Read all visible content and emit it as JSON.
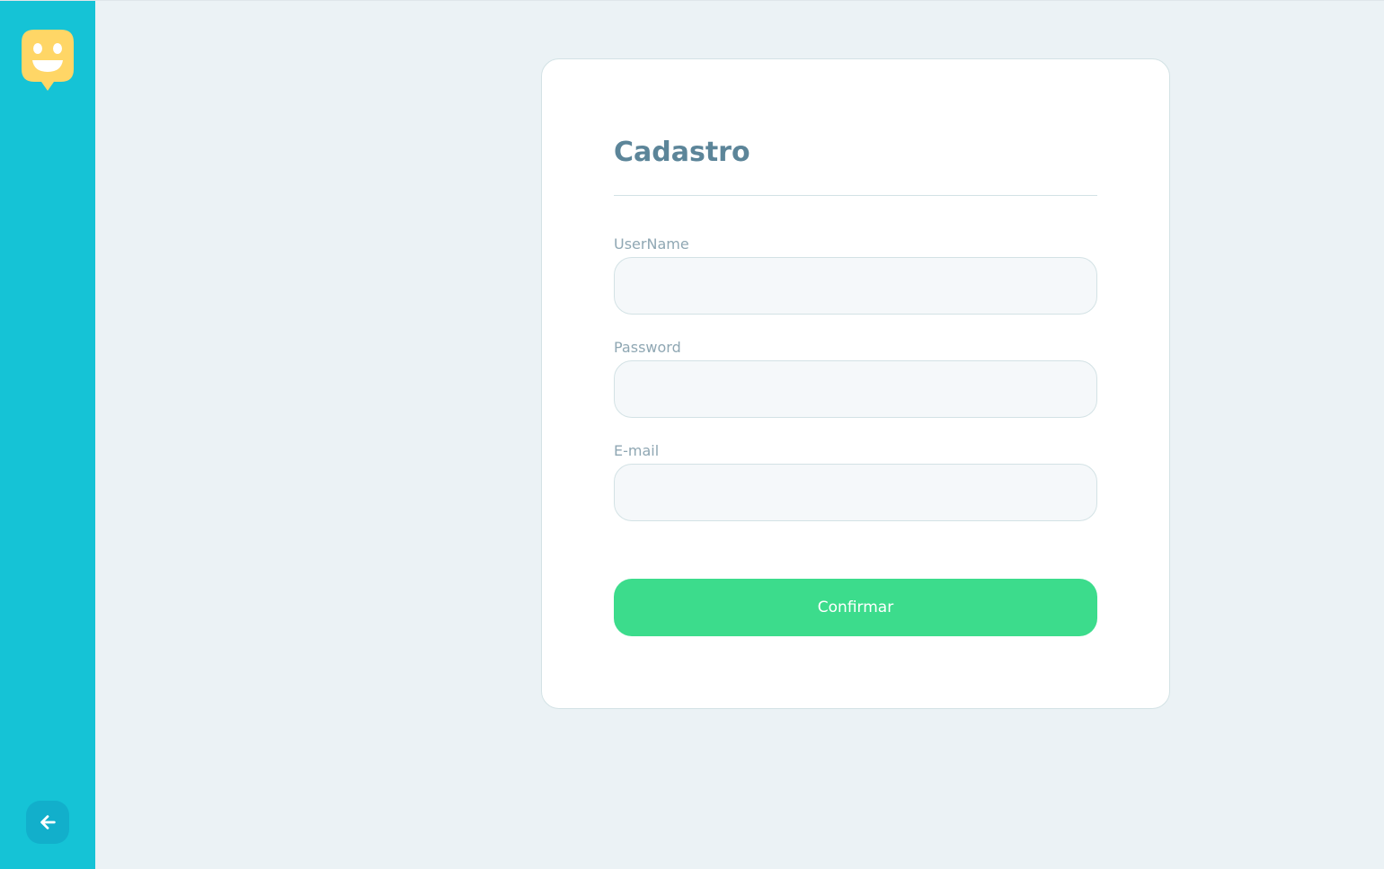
{
  "sidebar": {
    "logo_icon": "smiley-speech-bubble-icon",
    "back_icon": "arrow-left-icon",
    "colors": {
      "background": "#15c3d6",
      "back_button": "#12afcb",
      "logo": "#ffd666"
    }
  },
  "form": {
    "title": "Cadastro",
    "fields": [
      {
        "label": "UserName",
        "value": "",
        "placeholder": ""
      },
      {
        "label": "Password",
        "value": "",
        "placeholder": ""
      },
      {
        "label": "E-mail",
        "value": "",
        "placeholder": ""
      }
    ],
    "confirm_label": "Confirmar"
  },
  "colors": {
    "page_background": "#ebf2f5",
    "card_background": "#ffffff",
    "title": "#5c8599",
    "label": "#8fa7b3",
    "input_background": "#f5f8fa",
    "border": "#d3e2e5",
    "confirm_button": "#3cdc8c"
  }
}
